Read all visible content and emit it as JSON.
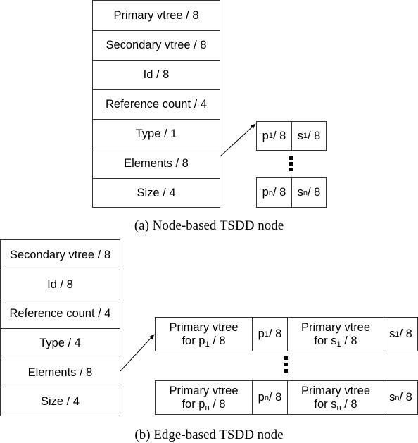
{
  "figure_a": {
    "caption": "(a) Node-based TSDD node",
    "fields": [
      "Primary vtree / 8",
      "Secondary vtree / 8",
      "Id / 8",
      "Reference count / 4",
      "Type / 1",
      "Elements / 8",
      "Size / 4"
    ],
    "element_pairs": [
      {
        "p_base": "p",
        "p_sub": "1",
        "p_size": " / 8",
        "s_base": "s",
        "s_sub": "1",
        "s_size": " / 8"
      },
      {
        "p_base": "p",
        "p_sub": "n",
        "p_size": " / 8",
        "s_base": "s",
        "s_sub": "n",
        "s_size": " / 8"
      }
    ]
  },
  "figure_b": {
    "caption": "(b) Edge-based TSDD node",
    "fields": [
      "Secondary vtree / 8",
      "Id / 8",
      "Reference count / 4",
      "Type / 4",
      "Elements / 8",
      "Size / 4"
    ],
    "element_rows": [
      {
        "pv_line1": "Primary vtree",
        "pv_line2_pre": "for p",
        "pv_sub": "1",
        "pv_line2_post": " / 8",
        "p_base": "p",
        "p_sub": "1",
        "p_size": " / 8",
        "sv_line1": "Primary vtree",
        "sv_line2_pre": "for s",
        "sv_sub": "1",
        "sv_line2_post": " / 8",
        "s_base": "s",
        "s_sub": "1",
        "s_size": " / 8"
      },
      {
        "pv_line1": "Primary vtree",
        "pv_line2_pre": "for p",
        "pv_sub": "n",
        "pv_line2_post": " / 8",
        "p_base": "p",
        "p_sub": "n",
        "p_size": " / 8",
        "sv_line1": "Primary vtree",
        "sv_line2_pre": "for s",
        "sv_sub": "n",
        "sv_line2_post": " / 8",
        "s_base": "s",
        "s_sub": "n",
        "s_size": " / 8"
      }
    ]
  }
}
